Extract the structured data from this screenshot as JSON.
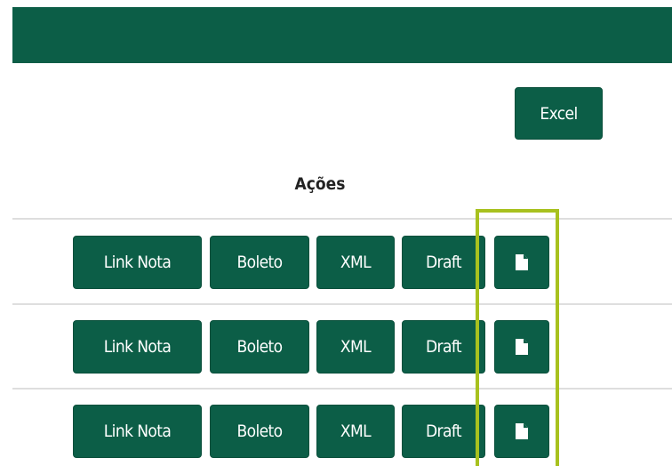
{
  "toolbar": {
    "excel_label": "Excel"
  },
  "table": {
    "actions_header": "Ações",
    "rows": [
      {
        "link_nota_label": "Link Nota",
        "boleto_label": "Boleto",
        "xml_label": "XML",
        "draft_label": "Draft",
        "doc_icon": "file-icon"
      },
      {
        "link_nota_label": "Link Nota",
        "boleto_label": "Boleto",
        "xml_label": "XML",
        "draft_label": "Draft",
        "doc_icon": "file-icon"
      },
      {
        "link_nota_label": "Link Nota",
        "boleto_label": "Boleto",
        "xml_label": "XML",
        "draft_label": "Draft",
        "doc_icon": "file-icon"
      }
    ]
  },
  "colors": {
    "primary_green": "#0c5e47",
    "highlight_yellow_green": "#a8c11f",
    "divider_gray": "#dedede"
  }
}
